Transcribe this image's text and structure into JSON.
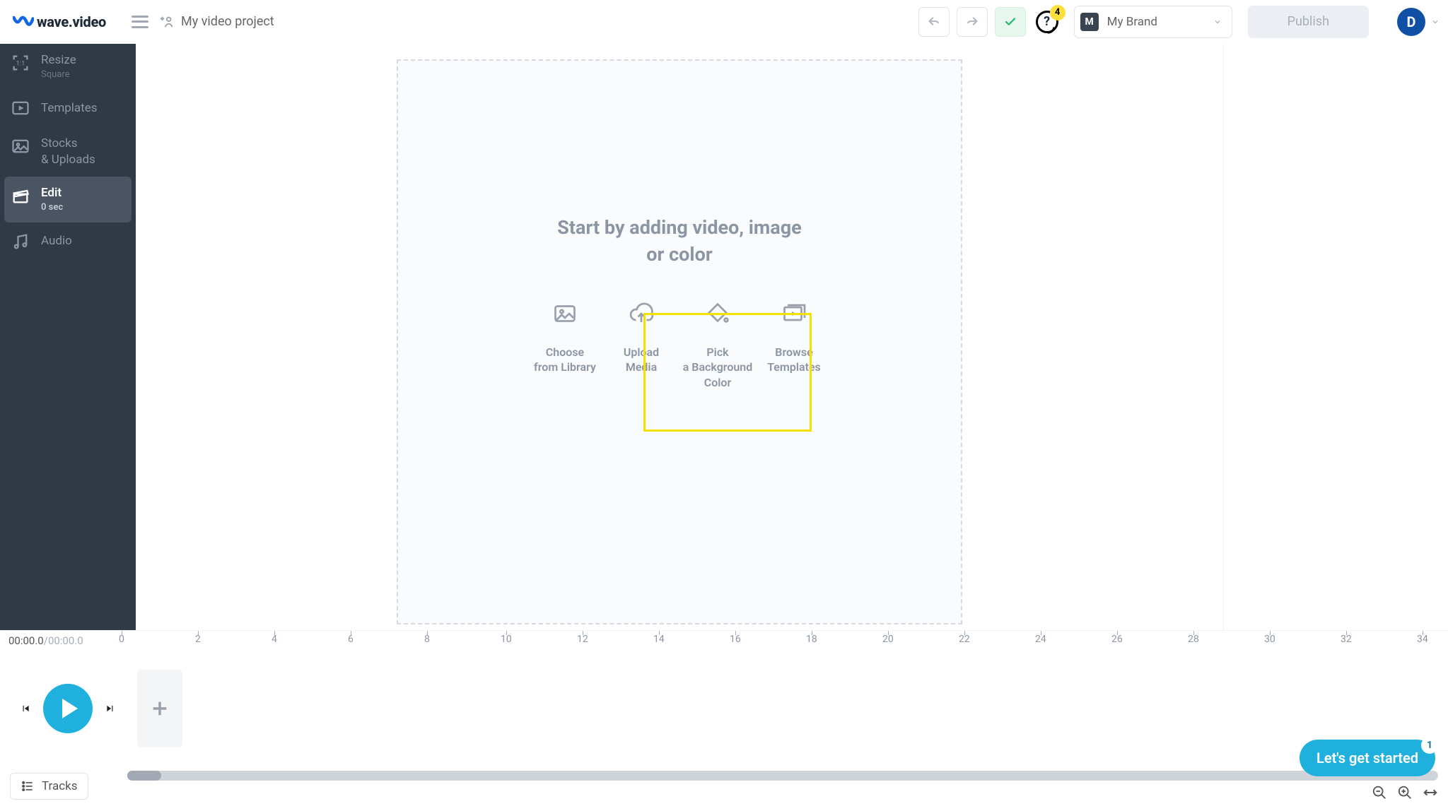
{
  "header": {
    "logo_text": "wave.video",
    "project_title": "My video project",
    "help_badge": "4",
    "brand_chip": "M",
    "brand_label": "My Brand",
    "publish_label": "Publish",
    "avatar_initial": "D"
  },
  "sidebar": {
    "items": [
      {
        "label": "Resize",
        "sub": "Square"
      },
      {
        "label": "Templates"
      },
      {
        "label": "Stocks\n& Uploads"
      },
      {
        "label": "Edit",
        "sub": "0 sec"
      },
      {
        "label": "Audio"
      }
    ]
  },
  "canvas": {
    "heading_line1": "Start by adding video, image",
    "heading_line2": "or color",
    "options": [
      {
        "line1": "Choose",
        "line2": "from Library"
      },
      {
        "line1": "Upload",
        "line2": "Media"
      },
      {
        "line1": "Pick",
        "line2": "a Background",
        "line3": "Color"
      },
      {
        "line1": "Browse",
        "line2": "Templates"
      }
    ]
  },
  "timeline": {
    "time_current": "00:00.0",
    "time_total": "/00:00.0",
    "ticks": [
      "0",
      "2",
      "4",
      "6",
      "8",
      "10",
      "12",
      "14",
      "16",
      "18",
      "20",
      "22",
      "24",
      "26",
      "28",
      "30",
      "32",
      "34"
    ],
    "tracks_label": "Tracks"
  },
  "widget": {
    "label": "Let's get started",
    "badge": "1"
  }
}
